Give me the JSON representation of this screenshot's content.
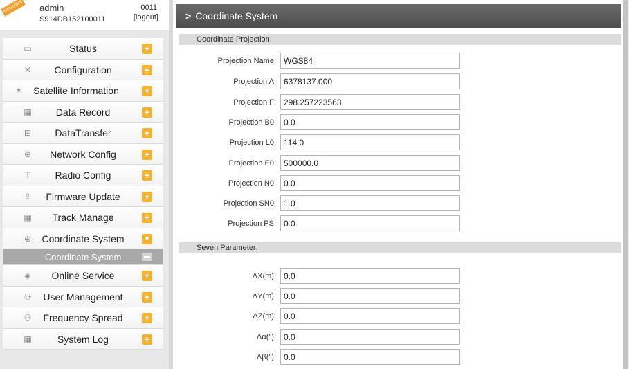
{
  "user": {
    "badge": "WELCOME",
    "name": "admin",
    "serial": "S914DB152100011",
    "code": "0011",
    "logout": "[logout]"
  },
  "menu": [
    {
      "label": "Status",
      "icon": "monitor-icon"
    },
    {
      "label": "Configuration",
      "icon": "tools-icon"
    },
    {
      "label": "Satellite Information",
      "icon": "satellite-icon"
    },
    {
      "label": "Data Record",
      "icon": "calendar-icon"
    },
    {
      "label": "DataTransfer",
      "icon": "network-computer-icon"
    },
    {
      "label": "Network Config",
      "icon": "globe-icon"
    },
    {
      "label": "Radio Config",
      "icon": "antenna-icon"
    },
    {
      "label": "Firmware Update",
      "icon": "upload-icon"
    },
    {
      "label": "Track Manage",
      "icon": "calendar-icon"
    },
    {
      "label": "Coordinate System",
      "icon": "globe-icon",
      "expanded": true
    },
    {
      "label": "Online Service",
      "icon": "cube-icon"
    },
    {
      "label": "User Management",
      "icon": "users-icon"
    },
    {
      "label": "Frequency Spread",
      "icon": "users-icon"
    },
    {
      "label": "System Log",
      "icon": "calendar-icon"
    }
  ],
  "submenu": {
    "label": "Coordinate System"
  },
  "page": {
    "title": "Coordinate System"
  },
  "projection": {
    "header": "Coordinate Projection:",
    "fields": [
      {
        "label": "Projection Name:",
        "value": "WGS84"
      },
      {
        "label": "Projection A:",
        "value": "6378137.000"
      },
      {
        "label": "Projection F:",
        "value": "298.257223563"
      },
      {
        "label": "Projection B0:",
        "value": "0.0"
      },
      {
        "label": "Projection L0:",
        "value": "114.0"
      },
      {
        "label": "Projection E0:",
        "value": "500000.0"
      },
      {
        "label": "Projection N0:",
        "value": "0.0"
      },
      {
        "label": "Projection SN0:",
        "value": "1.0"
      },
      {
        "label": "Projection PS:",
        "value": "0.0"
      }
    ]
  },
  "seven": {
    "header": "Seven Parameter:",
    "fields": [
      {
        "label": "ΔX(m):",
        "value": "0.0"
      },
      {
        "label": "ΔY(m):",
        "value": "0.0"
      },
      {
        "label": "ΔZ(m):",
        "value": "0.0"
      },
      {
        "label": "Δα(\"):",
        "value": "0.0"
      },
      {
        "label": "Δβ(\"):",
        "value": "0.0"
      }
    ]
  },
  "colors": {
    "accent": "#f5b230",
    "titlebar": "#5a5a5a",
    "submenu": "#a8a8a8"
  }
}
